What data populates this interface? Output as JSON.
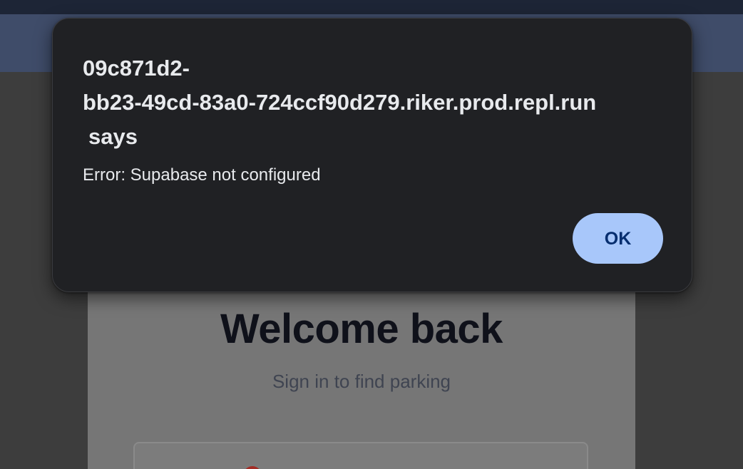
{
  "dialog": {
    "origin_part1": "09c871d2-",
    "origin_part2": "bb23-49cd-83a0-724ccf90d279.riker.prod.repl.run",
    "says": "says",
    "message": "Error: Supabase not configured",
    "ok_label": "OK"
  },
  "login": {
    "title": "Welcome back",
    "subtitle": "Sign in to find parking"
  },
  "colors": {
    "dialog_bg": "#202124",
    "ok_button_bg": "#a8c7fa",
    "ok_button_text": "#062e6f",
    "browser_bar": "#3f4c69"
  }
}
